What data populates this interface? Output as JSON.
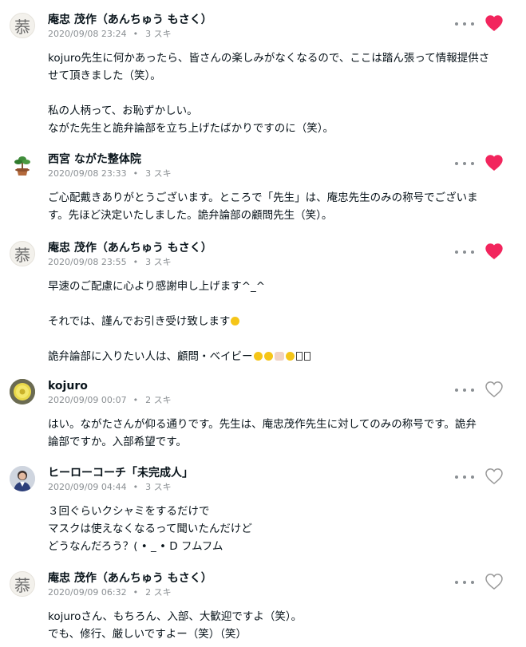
{
  "colors": {
    "heart_liked": "#f2255d",
    "heart_empty": "#999999",
    "meta": "#8a8f93",
    "text": "#08131a"
  },
  "comments": [
    {
      "name": "庵忠 茂作（あんちゅう もさく）",
      "date": "2020/09/08 23:24",
      "likes": "3 スキ",
      "liked": true,
      "avatar": "kanji-avatar",
      "avatar_text": "菾",
      "lines": [
        "kojuro先生に何かあったら、皆さんの楽しみがなくなるので、ここは踏ん張って情報提供さ",
        "せて頂きました（笑）。",
        "",
        "私の人柄って、お恥ずかしい。",
        "ながた先生と詭弁論部を立ち上げたばかりですのに（笑）。"
      ]
    },
    {
      "name": "西宮 ながた整体院",
      "date": "2020/09/08 23:33",
      "likes": "3 スキ",
      "liked": true,
      "avatar": "plant-avatar",
      "lines": [
        "ご心配戴きありがとうございます。ところで「先生」は、庵忠先生のみの称号でございま",
        "す。先ほど決定いたしました。詭弁論部の顧問先生（笑）。"
      ]
    },
    {
      "name": "庵忠 茂作（あんちゅう もさく）",
      "date": "2020/09/08 23:55",
      "likes": "3 スキ",
      "liked": true,
      "avatar": "kanji-avatar",
      "avatar_text": "菾",
      "lines": [
        "早速のご配慮に心より感謝申し上げます^_^",
        "",
        "それでは、謹んでお引き受け致します",
        "",
        "詭弁論部に入りたい人は、顧問・ベイビー"
      ]
    },
    {
      "name": "kojuro",
      "date": "2020/09/09 00:07",
      "likes": "2 スキ",
      "liked": false,
      "avatar": "flower-avatar",
      "lines": [
        "はい。ながたさんが仰る通りです。先生は、庵忠茂作先生に対してのみの称号です。詭弁",
        "論部ですか。入部希望です。"
      ]
    },
    {
      "name": "ヒーローコーチ「未完成人」",
      "date": "2020/09/09 04:44",
      "likes": "3 スキ",
      "liked": false,
      "avatar": "person-avatar",
      "lines": [
        "３回ぐらいクシャミをするだけで",
        "マスクは使えなくなるって聞いたんだけど",
        "どうなんだろう？( • _ • D フムフム"
      ]
    },
    {
      "name": "庵忠 茂作（あんちゅう もさく）",
      "date": "2020/09/09 06:32",
      "likes": "2 スキ",
      "liked": false,
      "avatar": "kanji-avatar",
      "avatar_text": "菾",
      "lines": [
        "kojuroさん、もちろん、入部、大歓迎ですよ（笑）。",
        "でも、修行、厳しいですよー（笑）（笑）"
      ]
    }
  ]
}
